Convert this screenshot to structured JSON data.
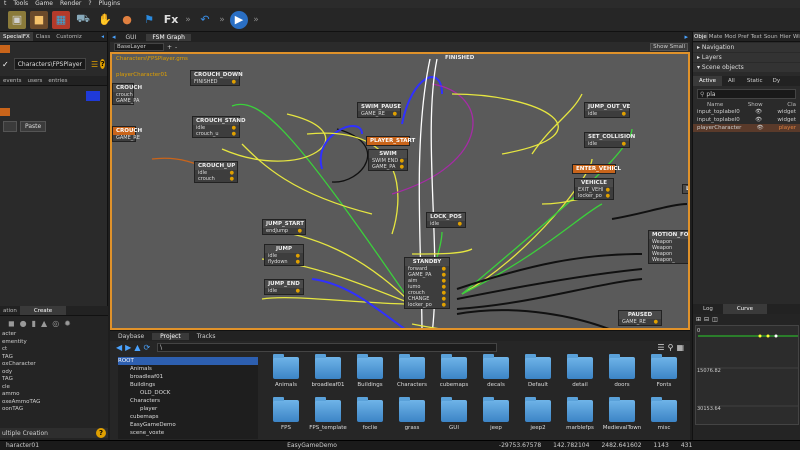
{
  "menubar": [
    "t",
    "Tools",
    "Game",
    "Render",
    "?",
    "Plugins"
  ],
  "toolbar": {
    "icons": [
      "cube-icon",
      "box-icon",
      "rubik-icon",
      "car-icon",
      "hand-icon",
      "sphere-icon",
      "flag-icon",
      "fx-icon",
      "undo-icon",
      "play-icon"
    ],
    "fx_label": "Fx"
  },
  "left": {
    "tabs": [
      "SpecialFX",
      "Class",
      "Customiz"
    ],
    "entity_field": "Characters\\FPSPlayer",
    "sub_tabs": [
      "events",
      "users",
      "entries"
    ],
    "paste_label": "Paste",
    "create_tabs": [
      "ation",
      "Create"
    ],
    "list": [
      "acter",
      "ementity",
      "ct",
      "TAG",
      "oxCharacter",
      "ody",
      "TAG",
      "cle",
      "ammo",
      "oxeAmmoTAG",
      "oonTAG"
    ],
    "multiple_creation": "ultiple Creation"
  },
  "center": {
    "tabs": [
      "GUI",
      "FSM Graph"
    ],
    "layer_select": "BaseLayer",
    "show_small": "Show Small",
    "breadcrumb": "Characters\\FPSPlayer.gms",
    "graph_name": "playerCharacter01",
    "nodes": [
      {
        "id": "crouch_down",
        "title": "CROUCH_DOWN",
        "rows": [
          "FINISHED"
        ]
      },
      {
        "id": "crouch",
        "title": "CROUCH",
        "rows": [
          "crouch",
          "GAME_PA"
        ]
      },
      {
        "id": "crouch_stand",
        "title": "CROUCH_STAND",
        "rows": [
          "idle",
          "crouch_u"
        ]
      },
      {
        "id": "crouch_up",
        "title": "CROUCH_UP",
        "rows": [
          "idle",
          "crouch"
        ]
      },
      {
        "id": "crouch2",
        "title": "CROUCH",
        "rows": [
          "GAME_RE"
        ]
      },
      {
        "id": "swim_pause",
        "title": "SWIM_PAUSE",
        "rows": [
          "GAME_RE"
        ]
      },
      {
        "id": "player_start",
        "title": "PLAYER_START",
        "rows": []
      },
      {
        "id": "swim",
        "title": "SWIM",
        "rows": [
          "SWIM END",
          "GAME_PA"
        ]
      },
      {
        "id": "finished_top",
        "title": "FINISHED",
        "rows": []
      },
      {
        "id": "jump_out_ve",
        "title": "JUMP_OUT_VE",
        "rows": [
          "idle"
        ]
      },
      {
        "id": "set_collision",
        "title": "SET_COLLISION",
        "rows": [
          "idle"
        ]
      },
      {
        "id": "enter_vehicle",
        "title": "ENTER_VEHICL",
        "rows": []
      },
      {
        "id": "vehicle",
        "title": "VEHICLE",
        "rows": [
          "EXIT_VEHI",
          "locker_po"
        ]
      },
      {
        "id": "jump_start",
        "title": "JUMP_START",
        "rows": [
          "endJump"
        ]
      },
      {
        "id": "jump",
        "title": "JUMP",
        "rows": [
          "idle",
          "flydown"
        ]
      },
      {
        "id": "jump_end",
        "title": "JUMP_END",
        "rows": [
          "idle"
        ]
      },
      {
        "id": "lock_pos",
        "title": "LOCK_POS",
        "rows": [
          "idle"
        ]
      },
      {
        "id": "standby",
        "title": "STANDBY",
        "rows": [
          "forward",
          "GAME_PA",
          "aim",
          "iumo",
          "crouch",
          "CHANGE",
          "locker_po"
        ]
      },
      {
        "id": "motion_for",
        "title": "MOTION_FOR",
        "rows": [
          "Weapon",
          "Weapon",
          "Weapon",
          "Weapon_"
        ]
      },
      {
        "id": "paused",
        "title": "PAUSED",
        "rows": [
          "GAME_RE"
        ]
      },
      {
        "id": "lo",
        "title": "LO",
        "rows": []
      }
    ]
  },
  "bottom": {
    "tabs": [
      "Daybase",
      "Project",
      "Tracks"
    ],
    "path": "\\",
    "tree": [
      "ROOT",
      "Animals",
      "broadleaf01",
      "Buildings",
      "OLD_DOCK",
      "Characters",
      "player",
      "cubemaps",
      "EasyGameDemo",
      "scene_voxte"
    ],
    "folders": [
      "Animals",
      "broadleaf01",
      "Buildings",
      "Characters",
      "cubemaps",
      "decals",
      "Default",
      "detail",
      "doors",
      "Fonts",
      "FPS",
      "FPS_template",
      "foclie",
      "grass",
      "GUI",
      "jeep",
      "jeep2",
      "marblefps",
      "MedievalTown",
      "misc"
    ]
  },
  "right": {
    "tabs": [
      "Obje",
      "Mate",
      "Mod",
      "Pref",
      "Text",
      "Soun",
      "Hier",
      "Wid"
    ],
    "sections": [
      "Navigation",
      "Layers",
      "Scene objects"
    ],
    "scene_tabs": [
      "Active",
      "All",
      "Static",
      "Dy"
    ],
    "search_value": "pla",
    "columns": [
      "Name",
      "Show",
      "Cla"
    ],
    "rows": [
      {
        "name": "input_toplabel0",
        "cls": "widget"
      },
      {
        "name": "input_toplabel0",
        "cls": "widget"
      },
      {
        "name": "playerCharacter",
        "cls": "player"
      }
    ],
    "curve_tabs": [
      "Log",
      "Curve"
    ],
    "curve_values": [
      "0",
      "15076.82",
      "30153.64"
    ]
  },
  "status": {
    "left": "haracter01",
    "center": "EasyGameDemo",
    "coords": [
      "-29753.67578",
      "142.782104",
      "2482.641602"
    ],
    "fps": "1143",
    "extra": "431"
  },
  "colors": {
    "graph_border": "#e0922a",
    "graph_bg": "#5a5a5a",
    "accent_blue": "#2d5fb0",
    "folder_blue": "#4e9ad6"
  }
}
